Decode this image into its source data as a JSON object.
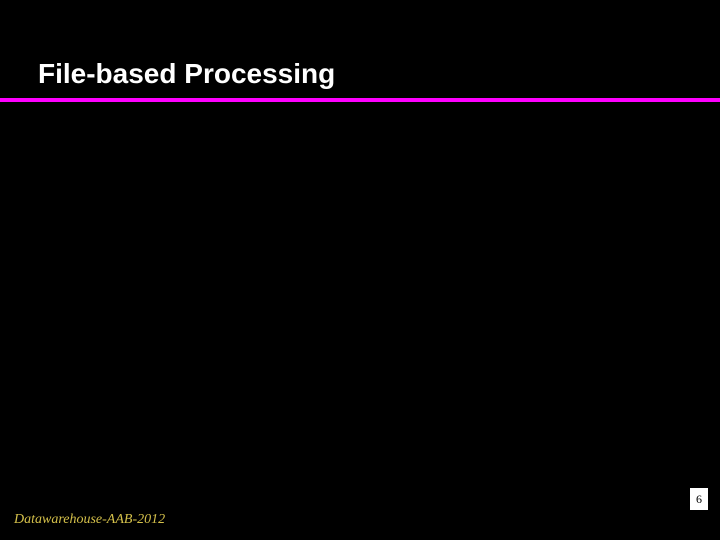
{
  "slide": {
    "title": "File-based Processing",
    "footer": "Datawarehouse-AAB-2012",
    "page_number": "6"
  }
}
